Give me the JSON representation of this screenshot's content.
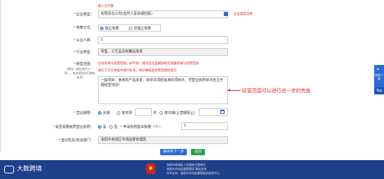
{
  "top_hint": "最少万元整",
  "form": {
    "enterprise_type": {
      "label": "企业类型：",
      "value": "有限责任公司(自然人投资或控股)",
      "side_note": "企业类型说明"
    },
    "accounting": {
      "label": "核算方式：",
      "options": [
        "独立核算",
        "非独立核算"
      ],
      "selected": 0
    },
    "employees": {
      "label": "从业人数：",
      "value": "2"
    },
    "industry": {
      "label": "行业类型：",
      "value": "零售、工艺品及收藏品批发"
    },
    "scope": {
      "label": "经营范围：",
      "side_note": "(增加（请在各栏分一项），有关规定自行增加本项)",
      "hint_line1": "已经有填写经营范围，如不想，请点击这里删除规范或重新填写经营范围",
      "hint_line2": "请在下方文本框中进行补充，请仔细核查经营范围后提交",
      "text": "一般项目：食用农产品批发；除依法须经批准的项目外，凭营业执照依法自主开展经营活动）",
      "annotation": "经营范围可以进行进一步的完善"
    },
    "term": {
      "label": "营业期限：",
      "options": [
        "长期",
        "按年限",
        "按日期(止营期限止)"
      ],
      "selected": 0,
      "year_unit": "年"
    },
    "license": {
      "label": "是否需要纸质营业执照：",
      "options": [
        "是",
        "否"
      ],
      "selected": 0,
      "copies_label": "* 申请执照副本数量（个）：",
      "copies_value": "1"
    },
    "authority": {
      "label": "登记机关/有关部门：",
      "value": "洛阳市老城区市场监督管理局"
    }
  },
  "buttons": {
    "save_next": "保存并下一步",
    "back": "返回"
  },
  "right_float": {
    "expand": "相同下载",
    "top": "Top"
  },
  "footer": {
    "logo_text": "大数跨境",
    "line1": "洛阳市老城区人民政府主管单位",
    "line2": "洛阳市市场监督管理局 服务咨询",
    "line3": "技术支持：洛阳市市场监督管理局信息中心"
  }
}
